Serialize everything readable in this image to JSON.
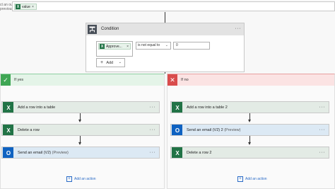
{
  "top": {
    "label_line1": "ct an output",
    "label_line2": "previous steps",
    "token_label": "value",
    "token_remove": "×"
  },
  "condition": {
    "title": "Condition",
    "menu": "···",
    "left_token_label": "Approve...",
    "left_token_remove": "×",
    "operator": "is not equal to",
    "operator_chevron": "⌄",
    "value": "0",
    "add_label": "Add",
    "add_plus": "+",
    "add_chevron": "⌄"
  },
  "yes_branch": {
    "title": "If yes",
    "icon": "✓",
    "actions": [
      {
        "label": "Add a row into a table",
        "preview": "",
        "menu": "···",
        "icon": "excel-icon"
      },
      {
        "label": "Delete a row",
        "preview": "",
        "menu": "···",
        "icon": "excel-icon"
      },
      {
        "label": "Send an email (V2)",
        "preview": "(Preview)",
        "menu": "···",
        "icon": "outlook-icon"
      }
    ],
    "add_action": "Add an action"
  },
  "no_branch": {
    "title": "If no",
    "icon": "✕",
    "actions": [
      {
        "label": "Add a row into a table 2",
        "preview": "",
        "menu": "···",
        "icon": "excel-icon"
      },
      {
        "label": "Send an email (V2) 2",
        "preview": "(Preview)",
        "menu": "···",
        "icon": "outlook-icon"
      },
      {
        "label": "Delete a row 2",
        "preview": "",
        "menu": "···",
        "icon": "excel-icon"
      }
    ],
    "add_action": "Add an action"
  },
  "colors": {
    "excel": "#217346",
    "outlook": "#0f62c1",
    "yes": "#3fa654",
    "no": "#d94c4c",
    "link": "#2a6bc7"
  }
}
